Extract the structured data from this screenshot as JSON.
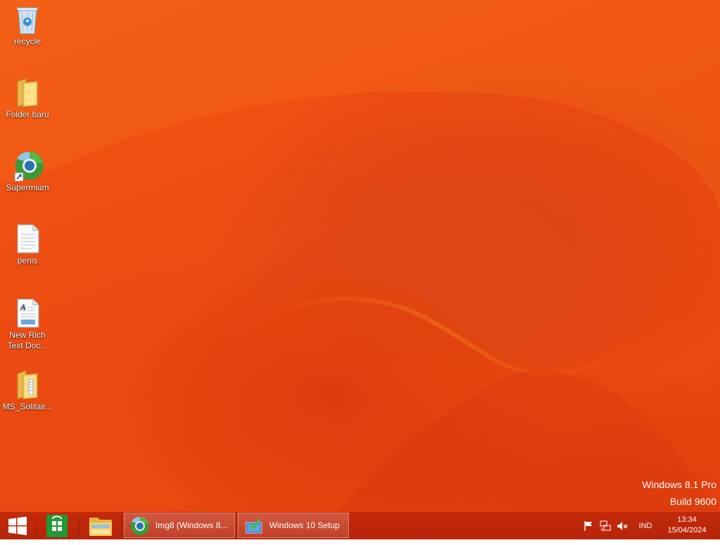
{
  "desktop": {
    "icons": [
      {
        "label": "recycle",
        "icon": "recycle-bin-icon"
      },
      {
        "label": "Folder baru",
        "icon": "folder-icon"
      },
      {
        "label": "Supermium",
        "icon": "supermium-browser-icon"
      },
      {
        "label": "penis",
        "icon": "text-document-icon"
      },
      {
        "label": "New Rich Text Doc...",
        "icon": "rich-text-document-icon"
      },
      {
        "label": "MS_Solitair...",
        "icon": "zip-folder-icon"
      }
    ],
    "watermark": {
      "line1": "Windows 8.1 Pro",
      "line2": "Build 9600"
    }
  },
  "taskbar": {
    "pinned": [
      {
        "name": "start",
        "icon": "windows-logo-icon"
      },
      {
        "name": "store",
        "icon": "store-bag-icon"
      },
      {
        "name": "file-explorer",
        "icon": "folder-icon"
      }
    ],
    "tasks": [
      {
        "label": "Img8 (Windows 8...",
        "icon": "supermium-browser-icon"
      },
      {
        "label": "Windows 10 Setup",
        "icon": "setup-icon"
      }
    ],
    "tray": {
      "icons": [
        "action-center-flag-icon",
        "network-icon",
        "speaker-muted-icon"
      ],
      "language": "IND",
      "time": "13:34",
      "date": "15/04/2024"
    }
  },
  "colors": {
    "wallpaper": "#ee4f12",
    "taskbar": "#c02a0a",
    "text": "#ffffff"
  }
}
